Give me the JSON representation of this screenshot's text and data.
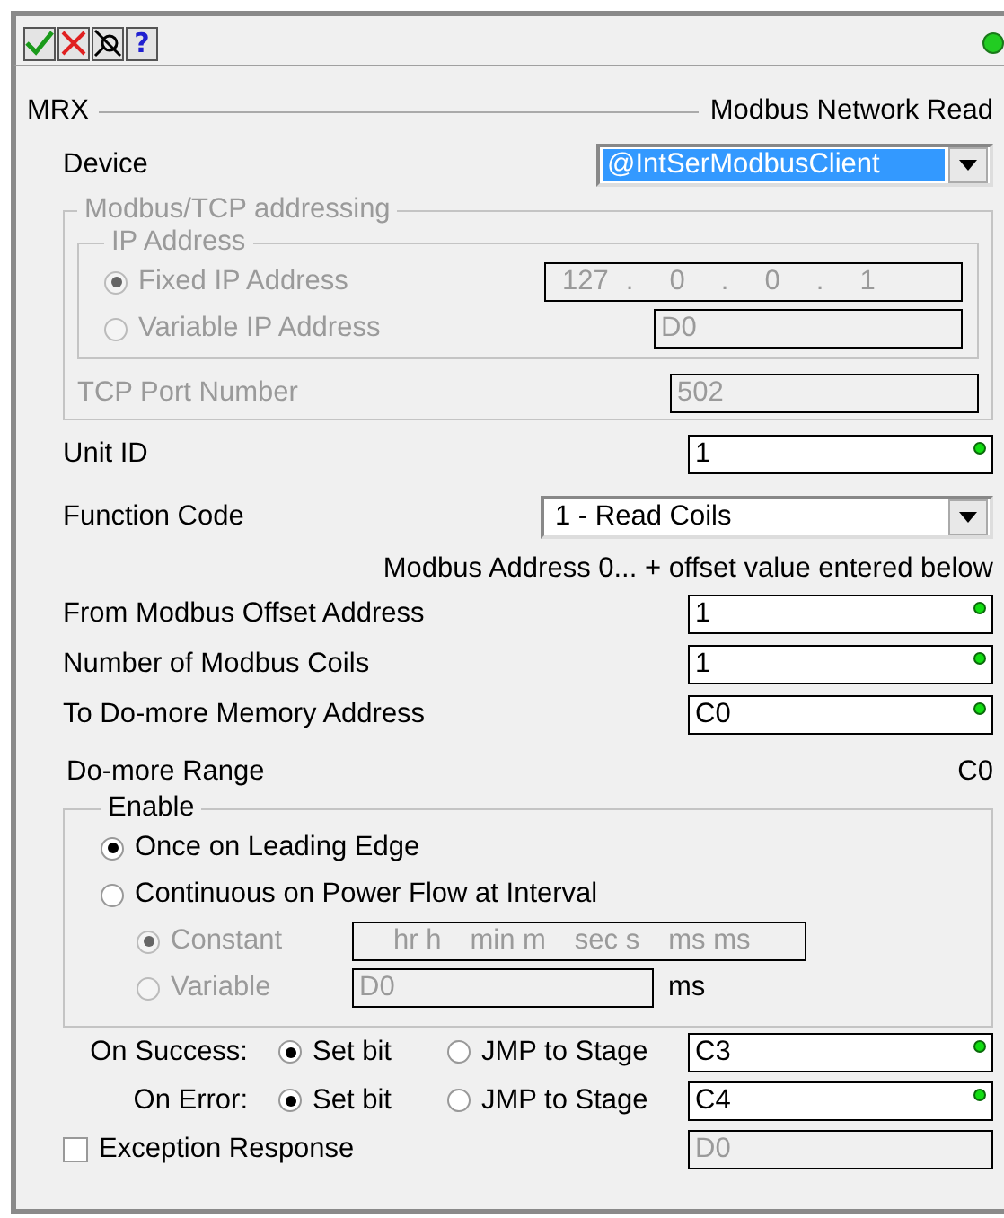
{
  "toolbar": {
    "buttons": [
      {
        "kind": "accept"
      },
      {
        "kind": "cancel"
      },
      {
        "kind": "tools"
      },
      {
        "kind": "help",
        "label": "?"
      }
    ],
    "status_ok": true
  },
  "header": {
    "mnemonic": "MRX",
    "title": "Modbus Network Read"
  },
  "device": {
    "label": "Device",
    "value": "@IntSerModbusClient",
    "focused": true
  },
  "tcp": {
    "legend": "Modbus/TCP addressing",
    "disabled": true,
    "ip": {
      "legend": "IP Address",
      "options": [
        {
          "label": "Fixed IP Address",
          "selected": true
        },
        {
          "label": "Variable IP Address",
          "selected": false
        }
      ],
      "octets": [
        "127",
        "0",
        "0",
        "1"
      ],
      "separator": ".",
      "variable": "D0"
    },
    "port": {
      "label": "TCP Port Number",
      "value": "502"
    }
  },
  "unit_id": {
    "label": "Unit ID",
    "value": "1",
    "valid": true
  },
  "function_code": {
    "label": "Function Code",
    "value": "1 - Read Coils"
  },
  "address_note": "Modbus Address 0... + offset value entered below",
  "fields": [
    {
      "label": "From Modbus Offset Address",
      "value": "1",
      "valid": true
    },
    {
      "label": "Number of Modbus Coils",
      "value": "1",
      "valid": true
    },
    {
      "label": "To Do-more Memory Address",
      "value": "C0",
      "valid": true
    }
  ],
  "range": {
    "label": "Do-more Range",
    "value": "C0"
  },
  "enable": {
    "legend": "Enable",
    "options": [
      {
        "label": "Once on Leading Edge",
        "selected": true
      },
      {
        "label": "Continuous on Power Flow at Interval",
        "selected": false
      }
    ],
    "interval": {
      "disabled": true,
      "options": [
        {
          "label": "Constant",
          "selected": true
        },
        {
          "label": "Variable",
          "selected": false
        }
      ],
      "units": [
        "hr h",
        "min m",
        "sec s",
        "ms ms"
      ],
      "variable": "D0",
      "unit": "ms"
    }
  },
  "outcomes": [
    {
      "label": "On Success:",
      "options": [
        {
          "label": "Set bit",
          "selected": true
        },
        {
          "label": "JMP to Stage",
          "selected": false
        }
      ],
      "value": "C3",
      "valid": true
    },
    {
      "label": "On Error:",
      "options": [
        {
          "label": "Set bit",
          "selected": true
        },
        {
          "label": "JMP to Stage",
          "selected": false
        }
      ],
      "value": "C4",
      "valid": true
    }
  ],
  "exception": {
    "label": "Exception Response",
    "checked": false,
    "value": "D0"
  }
}
